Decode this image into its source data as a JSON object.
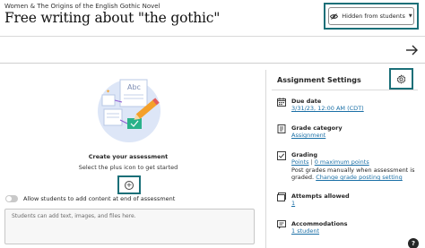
{
  "header": {
    "breadcrumb": "Women & The Origins of the English Gothic Novel",
    "title": "Free writing about \"the gothic\"",
    "visibility_label": "Hidden from students",
    "visibility_icon": "eye-slash-icon"
  },
  "nav": {
    "next_icon": "arrow-right-icon"
  },
  "content": {
    "illustration_text": "Abc",
    "create_title": "Create your assessment",
    "create_subtitle": "Select the plus icon to get started",
    "add_icon": "plus-circle-icon",
    "toggle_label": "Allow students to add content at end of assessment",
    "toggle_on": false,
    "student_content_placeholder": "Students can add text, images, and files here."
  },
  "settings": {
    "title": "Assignment Settings",
    "settings_icon": "gear-icon",
    "due_date": {
      "label": "Due date",
      "value": "3/31/23, 12:00 AM (CDT)",
      "icon": "calendar-icon"
    },
    "grade_category": {
      "label": "Grade category",
      "value": "Assignment",
      "icon": "gradebook-icon"
    },
    "grading": {
      "label": "Grading",
      "icon": "grading-icon",
      "scheme": "Points",
      "separator": "|",
      "max_points": "0 maximum points",
      "note_prefix": "Post grades manually when assessment is",
      "note_graded": "graded.",
      "change_link": "Change grade posting setting"
    },
    "attempts": {
      "label": "Attempts allowed",
      "value": "1",
      "icon": "attempts-icon"
    },
    "accommodations": {
      "label": "Accommodations",
      "value": "1 student",
      "icon": "accommodations-icon"
    }
  },
  "help": {
    "label": "?"
  },
  "colors": {
    "highlight": "#1b6f78",
    "link": "#1a6fa6",
    "text": "#262626",
    "illustration_bg": "#dde6f7",
    "illustration_accent": "#f4a02a",
    "illustration_green": "#2ab28a",
    "illustration_purple": "#8e5bd1"
  }
}
